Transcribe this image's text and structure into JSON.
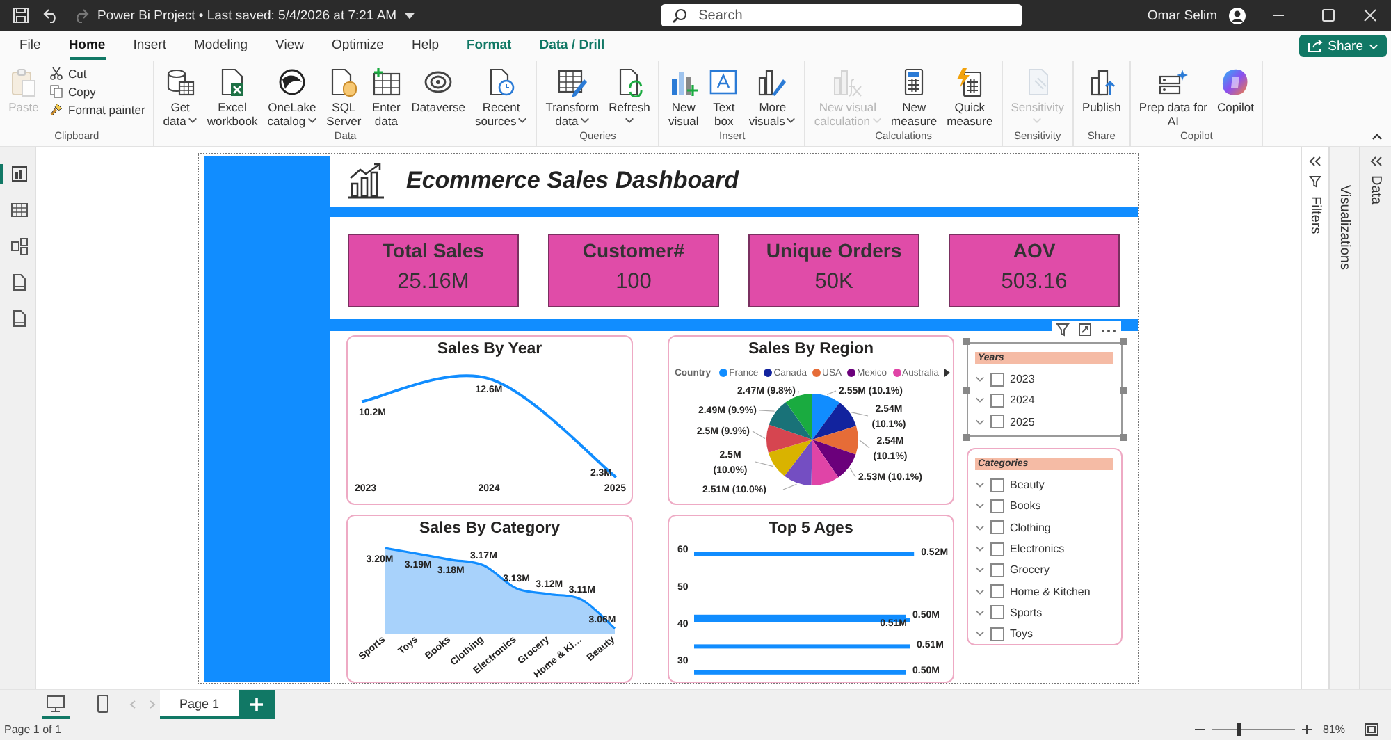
{
  "window": {
    "title": "Power Bi Project • Last saved: 5/4/2026 at 7:21 AM",
    "user": "Omar Selim"
  },
  "search": {
    "placeholder": "Search"
  },
  "menu_tabs": [
    {
      "label": "File",
      "selected": false,
      "contextual": false
    },
    {
      "label": "Home",
      "selected": true,
      "contextual": false
    },
    {
      "label": "Insert",
      "selected": false,
      "contextual": false
    },
    {
      "label": "Modeling",
      "selected": false,
      "contextual": false
    },
    {
      "label": "View",
      "selected": false,
      "contextual": false
    },
    {
      "label": "Optimize",
      "selected": false,
      "contextual": false
    },
    {
      "label": "Help",
      "selected": false,
      "contextual": false
    },
    {
      "label": "Format",
      "selected": false,
      "contextual": true
    },
    {
      "label": "Data / Drill",
      "selected": false,
      "contextual": true
    }
  ],
  "share_button": {
    "label": "Share"
  },
  "ribbon": {
    "groups": [
      {
        "label": "Clipboard",
        "buttons": [
          {
            "kind": "large",
            "lines": [
              "Paste"
            ],
            "dropdown": false,
            "disabled": true
          },
          {
            "kind": "small",
            "lines": [
              "Cut"
            ],
            "dropdown": false,
            "disabled": false
          },
          {
            "kind": "small",
            "lines": [
              "Copy"
            ],
            "dropdown": false,
            "disabled": false
          },
          {
            "kind": "small",
            "lines": [
              "Format painter"
            ],
            "dropdown": false,
            "disabled": false
          }
        ]
      },
      {
        "label": "Data",
        "buttons": [
          {
            "kind": "large",
            "lines": [
              "Get",
              "data"
            ],
            "dropdown": true,
            "disabled": false
          },
          {
            "kind": "large",
            "lines": [
              "Excel",
              "workbook"
            ],
            "dropdown": false,
            "disabled": false
          },
          {
            "kind": "large",
            "lines": [
              "OneLake",
              "catalog"
            ],
            "dropdown": true,
            "disabled": false
          },
          {
            "kind": "large",
            "lines": [
              "SQL",
              "Server"
            ],
            "dropdown": false,
            "disabled": false
          },
          {
            "kind": "large",
            "lines": [
              "Enter",
              "data"
            ],
            "dropdown": false,
            "disabled": false
          },
          {
            "kind": "large",
            "lines": [
              "Dataverse"
            ],
            "dropdown": false,
            "disabled": false
          },
          {
            "kind": "large",
            "lines": [
              "Recent",
              "sources"
            ],
            "dropdown": true,
            "disabled": false
          }
        ]
      },
      {
        "label": "Queries",
        "buttons": [
          {
            "kind": "large",
            "lines": [
              "Transform",
              "data"
            ],
            "dropdown": true,
            "disabled": false
          },
          {
            "kind": "large",
            "lines": [
              "Refresh"
            ],
            "dropdown": true,
            "disabled": false
          }
        ]
      },
      {
        "label": "Insert",
        "buttons": [
          {
            "kind": "large",
            "lines": [
              "New",
              "visual"
            ],
            "dropdown": false,
            "disabled": false
          },
          {
            "kind": "large",
            "lines": [
              "Text",
              "box"
            ],
            "dropdown": false,
            "disabled": false
          },
          {
            "kind": "large",
            "lines": [
              "More",
              "visuals"
            ],
            "dropdown": true,
            "disabled": false
          }
        ]
      },
      {
        "label": "Calculations",
        "buttons": [
          {
            "kind": "large",
            "lines": [
              "New visual",
              "calculation"
            ],
            "dropdown": true,
            "disabled": true
          },
          {
            "kind": "large",
            "lines": [
              "New",
              "measure"
            ],
            "dropdown": false,
            "disabled": false
          },
          {
            "kind": "large",
            "lines": [
              "Quick",
              "measure"
            ],
            "dropdown": false,
            "disabled": false
          }
        ]
      },
      {
        "label": "Sensitivity",
        "buttons": [
          {
            "kind": "large",
            "lines": [
              "Sensitivity"
            ],
            "dropdown": true,
            "disabled": true
          }
        ]
      },
      {
        "label": "Share",
        "buttons": [
          {
            "kind": "large",
            "lines": [
              "Publish"
            ],
            "dropdown": false,
            "disabled": false
          }
        ]
      },
      {
        "label": "Copilot",
        "buttons": [
          {
            "kind": "large",
            "lines": [
              "Prep data for",
              "AI"
            ],
            "dropdown": false,
            "disabled": false
          },
          {
            "kind": "large",
            "lines": [
              "Copilot"
            ],
            "dropdown": false,
            "disabled": false
          }
        ]
      }
    ]
  },
  "nav_rail": [
    {
      "selected": true
    },
    {
      "selected": false
    },
    {
      "selected": false
    },
    {
      "selected": false
    },
    {
      "selected": false
    }
  ],
  "report": {
    "title": "Ecommerce Sales Dashboard",
    "kpis": [
      {
        "label": "Total Sales",
        "value": "25.16M"
      },
      {
        "label": "Customer#",
        "value": "100"
      },
      {
        "label": "Unique Orders",
        "value": "50K"
      },
      {
        "label": "AOV",
        "value": "503.16"
      }
    ],
    "visuals": [
      {
        "chart_data": {
          "type": "line",
          "title": "Sales By Year",
          "categories": [
            "2023",
            "2024",
            "2025"
          ],
          "values": [
            10.2,
            12.6,
            2.3
          ],
          "value_labels": [
            "10.2M",
            "12.6M",
            "2.3M"
          ]
        }
      },
      {
        "legend": {
          "title": "Country",
          "items": [
            {
              "name": "France",
              "color": "#118dff"
            },
            {
              "name": "Canada",
              "color": "#12239e"
            },
            {
              "name": "USA",
              "color": "#e66c37"
            },
            {
              "name": "Mexico",
              "color": "#6b007b"
            },
            {
              "name": "Australia",
              "color": "#e044a7"
            }
          ]
        },
        "slices": [
          {
            "color": "#118dff"
          },
          {
            "color": "#12239e"
          },
          {
            "color": "#e66c37"
          },
          {
            "color": "#6b007b"
          },
          {
            "color": "#e044a7"
          },
          {
            "color": "#744ec2"
          },
          {
            "color": "#d9b300"
          },
          {
            "color": "#d64550"
          },
          {
            "color": "#197278"
          },
          {
            "color": "#1aab40"
          }
        ],
        "chart_data": {
          "type": "pie",
          "title": "Sales By Region",
          "values": [
            10.1,
            10.1,
            10.1,
            10.1,
            10.0,
            10.0,
            10.0,
            9.9,
            9.9,
            9.8
          ],
          "value_labels": [
            "2.55M (10.1%)",
            "2.54M (10.1%)",
            "2.54M (10.1%)",
            "2.53M (10.1%)",
            null,
            "2.51M (10.0%)",
            "2.5M (10.0%)",
            "2.5M (9.9%)",
            "2.49M (9.9%)",
            "2.47M (9.8%)"
          ]
        }
      },
      {
        "chart_data": {
          "type": "area",
          "title": "Sales By Category",
          "categories": [
            "Sports",
            "Toys",
            "Books",
            "Clothing",
            "Electronics",
            "Grocery",
            "Home & Ki…",
            "Beauty"
          ],
          "values": [
            3.2,
            3.19,
            3.18,
            3.17,
            3.13,
            3.12,
            3.11,
            3.06
          ],
          "value_labels": [
            "3.20M",
            "3.19M",
            "3.18M",
            "3.17M",
            "3.13M",
            "3.12M",
            "3.11M",
            "3.06M"
          ]
        }
      },
      {
        "chart_data": {
          "type": "bar",
          "orientation": "horizontal",
          "title": "Top 5 Ages",
          "x": [
            59,
            42,
            41,
            34,
            27
          ],
          "values": [
            0.52,
            0.5,
            0.51,
            0.51,
            0.5
          ],
          "ylim": [
            27,
            60
          ],
          "yticks": [
            30,
            40,
            50,
            60
          ],
          "value_labels": [
            "0.52M",
            "0.50M",
            "0.51M",
            "0.51M",
            "0.50M"
          ]
        }
      }
    ],
    "slicers": [
      {
        "title": "Years",
        "selected": true,
        "items": [
          {
            "label": "2023",
            "checked": false
          },
          {
            "label": "2024",
            "checked": false
          },
          {
            "label": "2025",
            "checked": false
          }
        ]
      },
      {
        "title": "Categories",
        "selected": false,
        "items": [
          {
            "label": "Beauty",
            "checked": false
          },
          {
            "label": "Books",
            "checked": false
          },
          {
            "label": "Clothing",
            "checked": false
          },
          {
            "label": "Electronics",
            "checked": false
          },
          {
            "label": "Grocery",
            "checked": false
          },
          {
            "label": "Home & Kitchen",
            "checked": false
          },
          {
            "label": "Sports",
            "checked": false
          },
          {
            "label": "Toys",
            "checked": false
          }
        ]
      }
    ]
  },
  "panes": [
    {
      "label": "Filters"
    },
    {
      "label": "Visualizations"
    },
    {
      "label": "Data"
    }
  ],
  "page_bar": {
    "views": [
      {
        "selected": true
      },
      {
        "selected": false
      }
    ],
    "pages": [
      {
        "label": "Page 1",
        "selected": true
      }
    ]
  },
  "status_bar": {
    "page": "Page 1 of 1",
    "zoom": {
      "level": 0.32,
      "reading": "81%"
    }
  }
}
